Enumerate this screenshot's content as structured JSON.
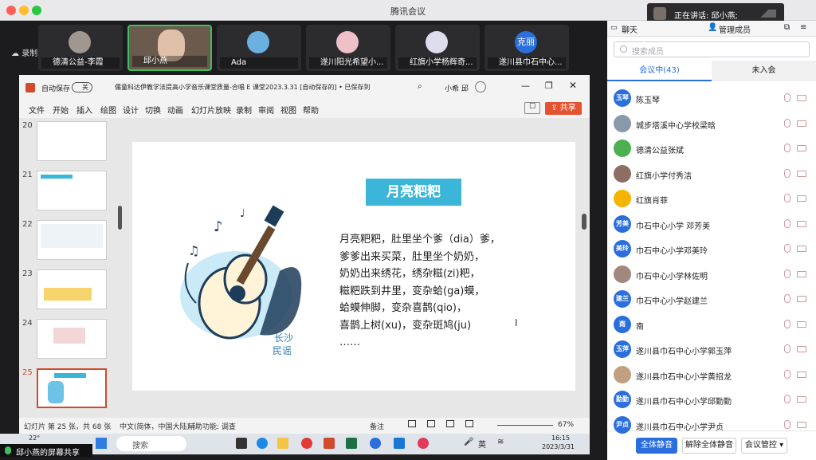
{
  "window": {
    "title": "腾讯会议"
  },
  "speaking": {
    "label": "正在讲话: 邱小燕;"
  },
  "recording": {
    "label": "录制中"
  },
  "participants_strip": [
    {
      "name": "德清公益-李霞",
      "avatar": ""
    },
    {
      "name": "邱小燕",
      "avatar": ""
    },
    {
      "name": "Ada",
      "avatar": ""
    },
    {
      "name": "遂川阳光希望小...",
      "avatar": ""
    },
    {
      "name": "红旗小学杨辉奇...",
      "avatar": ""
    },
    {
      "name": "遂川县巾石中心...",
      "avatar": "克丽"
    }
  ],
  "ppt": {
    "autosave_label": "自动保存",
    "autosave_state": "关",
    "filename": "儒童科达伊教学法提高小学音乐课堂质量-合唱 E 课堂2023.3.31 [自动保存的] • 已保存到这台电脑",
    "user": "小希 邱",
    "menu": [
      "文件",
      "开始",
      "插入",
      "绘图",
      "设计",
      "切换",
      "动画",
      "幻灯片放映",
      "录制",
      "审阅",
      "视图",
      "帮助"
    ],
    "share_button": "共享",
    "thumb_numbers": [
      "20",
      "21",
      "22",
      "23",
      "24",
      "25"
    ],
    "status_left": "幻灯片 第 25 张，共 68 张",
    "status_lang": "中文(简体，中国大陆)",
    "status_access": "辅助功能: 调查",
    "status_notes": "备注",
    "zoom": "67%"
  },
  "slide": {
    "title": "月亮粑粑",
    "poem": [
      "月亮粑粑，肚里坐个爹（dia）爹，",
      "爹爹出来买菜，肚里坐个奶奶，",
      "奶奶出来绣花，绣杂糍(zi)粑，",
      "糍粑跌到井里，变杂蛤(ga)蟆，",
      "蛤蟆伸脚，变杂喜鹊(qio)，",
      "喜鹊上树(xu)，变杂斑鸠(ju)",
      "……"
    ],
    "guitar_caption_1": "长沙",
    "guitar_caption_2": "民谣"
  },
  "taskbar": {
    "weather": "22°",
    "search": "搜索",
    "ime": "英",
    "time": "16:15",
    "date": "2023/3/31"
  },
  "panel": {
    "tab_chat": "聊天",
    "tab_members": "管理成员",
    "search_placeholder": "搜索成员",
    "in_meeting": "会议中(43)",
    "not_joined": "未入会",
    "members": [
      {
        "name": "陈玉琴",
        "avatar": "玉琴",
        "color": "#2a6fdb"
      },
      {
        "name": "城步塔溪中心学校梁晗",
        "avatar": "",
        "color": "#8899aa"
      },
      {
        "name": "德清公益张斌",
        "avatar": "",
        "color": "#4caf50"
      },
      {
        "name": "红旗小学付秀洁",
        "avatar": "",
        "color": "#8d6e63"
      },
      {
        "name": "红旗肖菲",
        "avatar": "",
        "color": "#f4b400"
      },
      {
        "name": "巾石中心小学 邓芳美",
        "avatar": "芳美",
        "color": "#2a6fdb"
      },
      {
        "name": "巾石中心小学邓美玲",
        "avatar": "美玲",
        "color": "#2a6fdb"
      },
      {
        "name": "巾石中心小学林佐明",
        "avatar": "",
        "color": "#a1887f"
      },
      {
        "name": "巾石中心小学赵建兰",
        "avatar": "建兰",
        "color": "#2a6fdb"
      },
      {
        "name": "南",
        "avatar": "南",
        "color": "#2a6fdb"
      },
      {
        "name": "遂川县巾石中心小学郭玉萍",
        "avatar": "玉萍",
        "color": "#2a6fdb"
      },
      {
        "name": "遂川县巾石中心小学黄招龙",
        "avatar": "",
        "color": "#c0a080"
      },
      {
        "name": "遂川县巾石中心小学邱勤勤",
        "avatar": "勤勤",
        "color": "#2a6fdb"
      },
      {
        "name": "遂川县巾石中心小学尹贞",
        "avatar": "尹贞",
        "color": "#2a6fdb"
      }
    ],
    "btn_mute_all": "全体静音",
    "btn_unmute_all": "解除全体静音",
    "btn_control": "会议管控"
  },
  "sharing_label": "邱小燕的屏幕共享"
}
